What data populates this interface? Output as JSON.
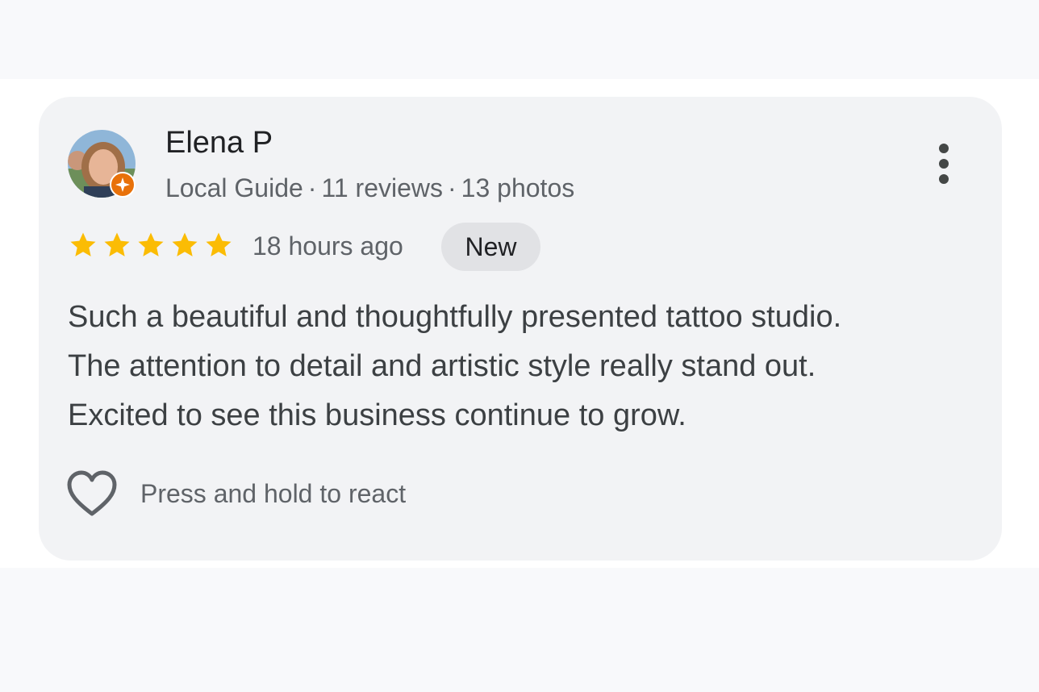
{
  "review": {
    "author_name": "Elena P",
    "author_meta": {
      "role": "Local Guide",
      "reviews": "11 reviews",
      "photos": "13 photos",
      "separator": "·"
    },
    "rating": 5,
    "rating_max": 5,
    "time_ago": "18 hours ago",
    "badge": "New",
    "text_lines": [
      "Such a beautiful and thoughtfully presented tattoo studio.",
      "The attention to detail and artistic style really stand out.",
      "Excited to see this business continue to grow."
    ],
    "react_label": "Press and hold to react"
  },
  "icons": {
    "star": "star-icon",
    "more": "more-vertical-icon",
    "heart": "heart-outline-icon",
    "local_guide": "local-guide-badge-icon"
  },
  "colors": {
    "star": "#fbbc04",
    "local_guide_badge": "#e8710a",
    "card_background": "#f2f3f5",
    "badge_background": "#e1e2e5",
    "secondary_text": "#5f6368"
  }
}
